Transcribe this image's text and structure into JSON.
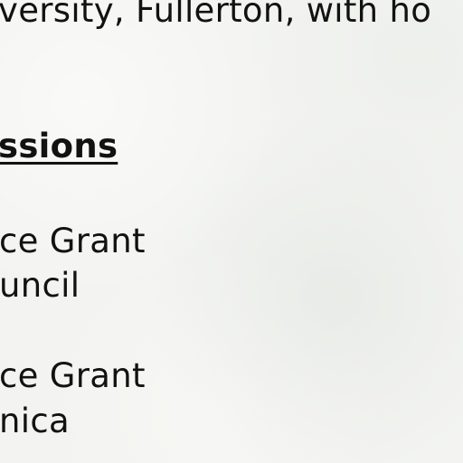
{
  "document": {
    "top_line": "versity, Fullerton, with ho",
    "section_heading": "ssions",
    "entries": [
      {
        "line1": "ce Grant",
        "line2": "uncil"
      },
      {
        "line1": "ce Grant",
        "line2": "nica"
      }
    ]
  }
}
